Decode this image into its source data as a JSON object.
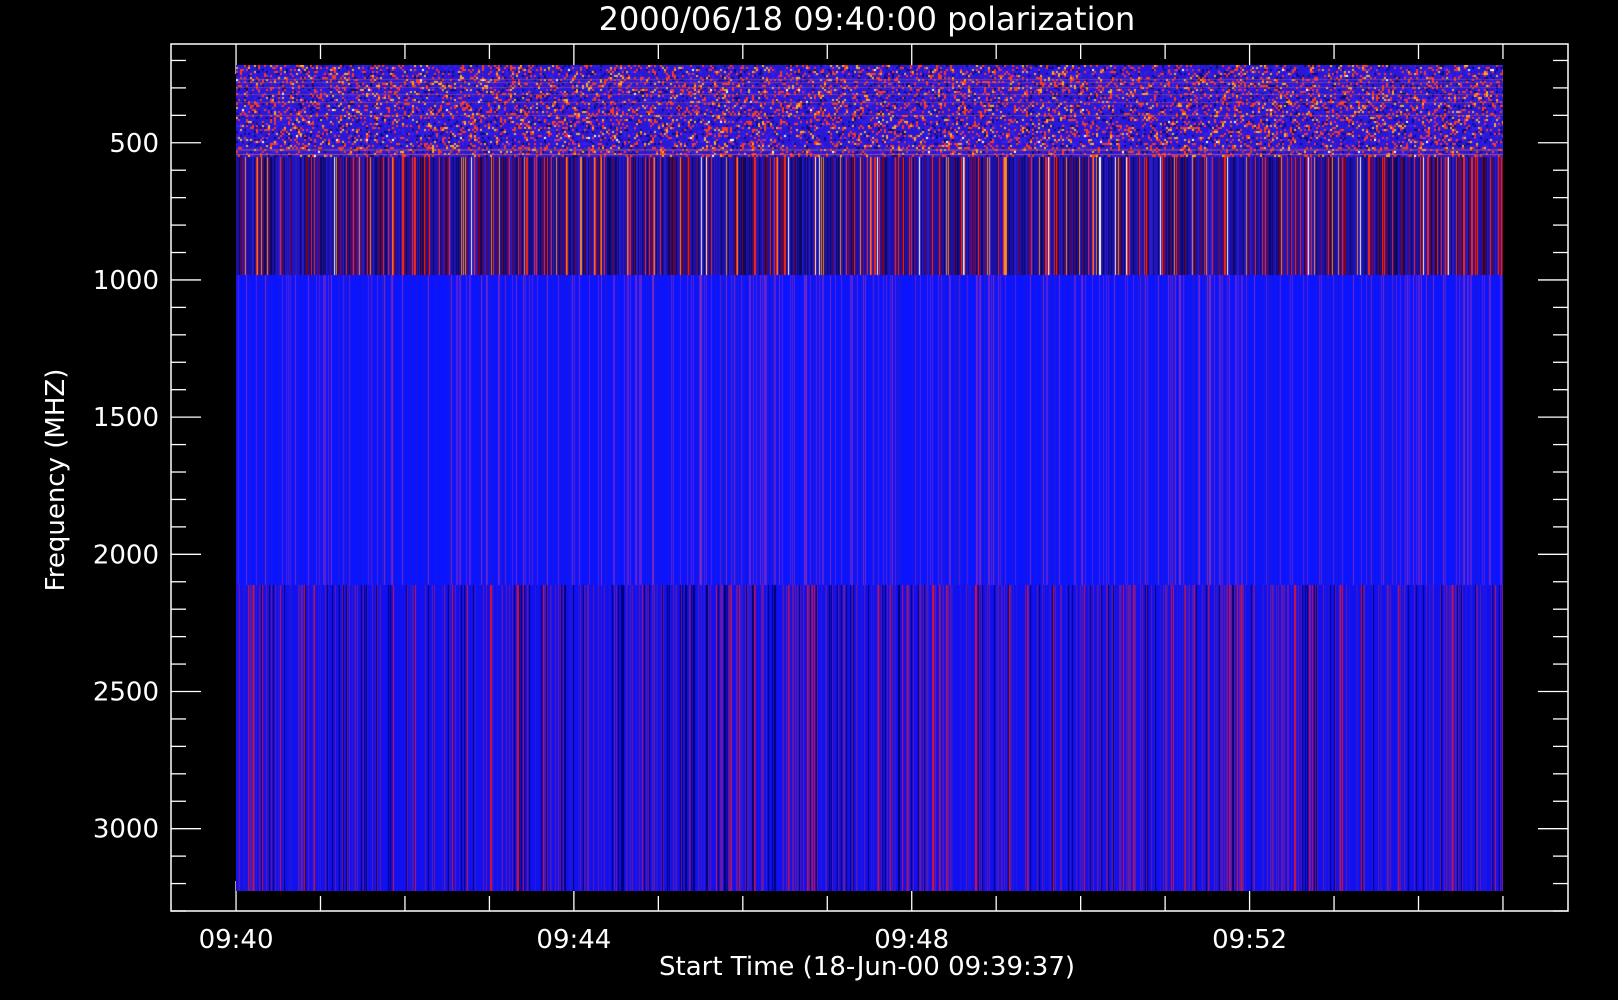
{
  "chart_data": {
    "type": "heatmap",
    "title": "2000/06/18 09:40:00 polarization",
    "xlabel": "Start Time (18-Jun-00 09:39:37)",
    "ylabel": "Frequency (MHZ)",
    "x_ticks": [
      {
        "label": "09:40",
        "minutes": 0
      },
      {
        "label": "09:44",
        "minutes": 4
      },
      {
        "label": "09:48",
        "minutes": 8
      },
      {
        "label": "09:52",
        "minutes": 12
      }
    ],
    "x_minor_step_minutes": 1,
    "x_data_range_minutes": [
      0,
      15
    ],
    "x_axis_range_minutes": [
      -0.77,
      15.77
    ],
    "y_ticks": [
      500,
      1000,
      1500,
      2000,
      2500,
      3000
    ],
    "y_minor_step": 100,
    "ylim": [
      3300,
      140
    ],
    "y_data_range": [
      3225,
      215
    ],
    "bands": [
      {
        "name": "band-1",
        "freq_range": [
          215,
          550
        ],
        "pattern": "speckled",
        "base_color": "#2a18d8",
        "accent_colors": [
          "#ff3b1a",
          "#ffb020",
          "#ffffff",
          "#c83080"
        ]
      },
      {
        "name": "band-2",
        "freq_range": [
          550,
          980
        ],
        "pattern": "vertical-stripes",
        "base_color": "#1a10a8",
        "accent_colors": [
          "#ff2a10",
          "#ff8a30",
          "#ffffff",
          "#800010"
        ]
      },
      {
        "name": "band-3",
        "freq_range": [
          980,
          2110
        ],
        "pattern": "vertical-stripes",
        "base_color": "#0a14ff",
        "accent_colors": [
          "#5a22d8",
          "#7a2ac0"
        ]
      },
      {
        "name": "band-4",
        "freq_range": [
          2110,
          3225
        ],
        "pattern": "vertical-stripes",
        "base_color": "#1010f0",
        "accent_colors": [
          "#e01030",
          "#6a1aa0",
          "#000070"
        ]
      }
    ],
    "grid": false,
    "background_color": "#000000",
    "foreground_color": "#ffffff"
  }
}
